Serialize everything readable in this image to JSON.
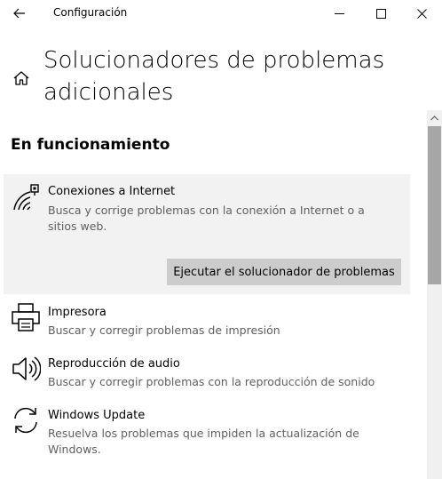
{
  "window": {
    "title": "Configuración",
    "controls": [
      "minimize-icon",
      "maximize-icon",
      "close-icon"
    ]
  },
  "header": {
    "title": "Solucionadores de problemas adicionales"
  },
  "section": {
    "title": "En funcionamiento"
  },
  "troubleshooters": [
    {
      "icon": "wifi-internet-icon",
      "name": "Conexiones a Internet",
      "description": "Busca y corrige problemas con la conexión a Internet o a sitios web.",
      "expanded": true,
      "run_button": "Ejecutar el solucionador de problemas"
    },
    {
      "icon": "printer-icon",
      "name": "Impresora",
      "description": "Buscar y corregir problemas de impresión"
    },
    {
      "icon": "speaker-icon",
      "name": "Reproducción de audio",
      "description": "Buscar y corregir problemas con la reproducción de sonido"
    },
    {
      "icon": "sync-icon",
      "name": "Windows Update",
      "description": "Resuelva los problemas que impiden la actualización de Windows."
    }
  ],
  "colors": {
    "expanded_bg": "#f2f2f2",
    "button_bg": "#cccccc",
    "description_text": "#5f5f5f",
    "scroll_thumb": "#a6a6a6"
  }
}
